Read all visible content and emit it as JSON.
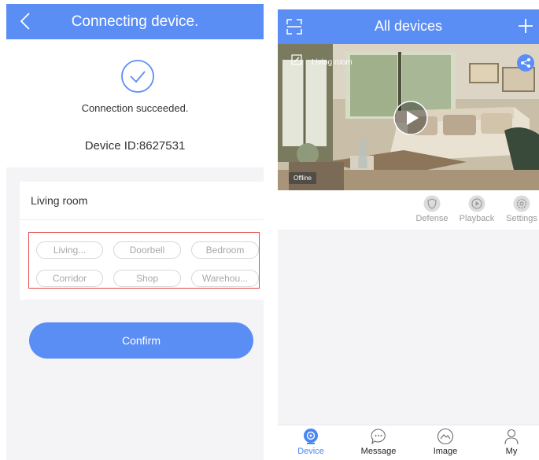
{
  "left_screen": {
    "header": {
      "title": "Connecting device."
    },
    "status": {
      "message": "Connection succeeded.",
      "device_id": "Device ID:8627531"
    },
    "name_field": {
      "value": "Living room"
    },
    "name_suggestions": [
      "Living...",
      "Doorbell",
      "Bedroom",
      "Corridor",
      "Shop",
      "Warehou..."
    ],
    "confirm_label": "Confirm"
  },
  "right_screen": {
    "header": {
      "title": "All devices"
    },
    "camera": {
      "name": "Living room",
      "status": "Offline"
    },
    "actions": [
      {
        "label": "Defense",
        "icon": "defense-icon"
      },
      {
        "label": "Playback",
        "icon": "playback-icon"
      },
      {
        "label": "Settings",
        "icon": "settings-icon"
      }
    ],
    "nav": [
      {
        "label": "Device",
        "icon": "device-icon",
        "active": true
      },
      {
        "label": "Message",
        "icon": "message-icon",
        "active": false
      },
      {
        "label": "Image",
        "icon": "image-icon",
        "active": false
      },
      {
        "label": "My",
        "icon": "person-icon",
        "active": false
      }
    ]
  },
  "colors": {
    "accent": "#5b8ef4",
    "active_tab": "#4a86f3",
    "highlight_border": "#e04b4b",
    "muted_text": "#9a9a9a",
    "background": "#f4f4f6"
  }
}
